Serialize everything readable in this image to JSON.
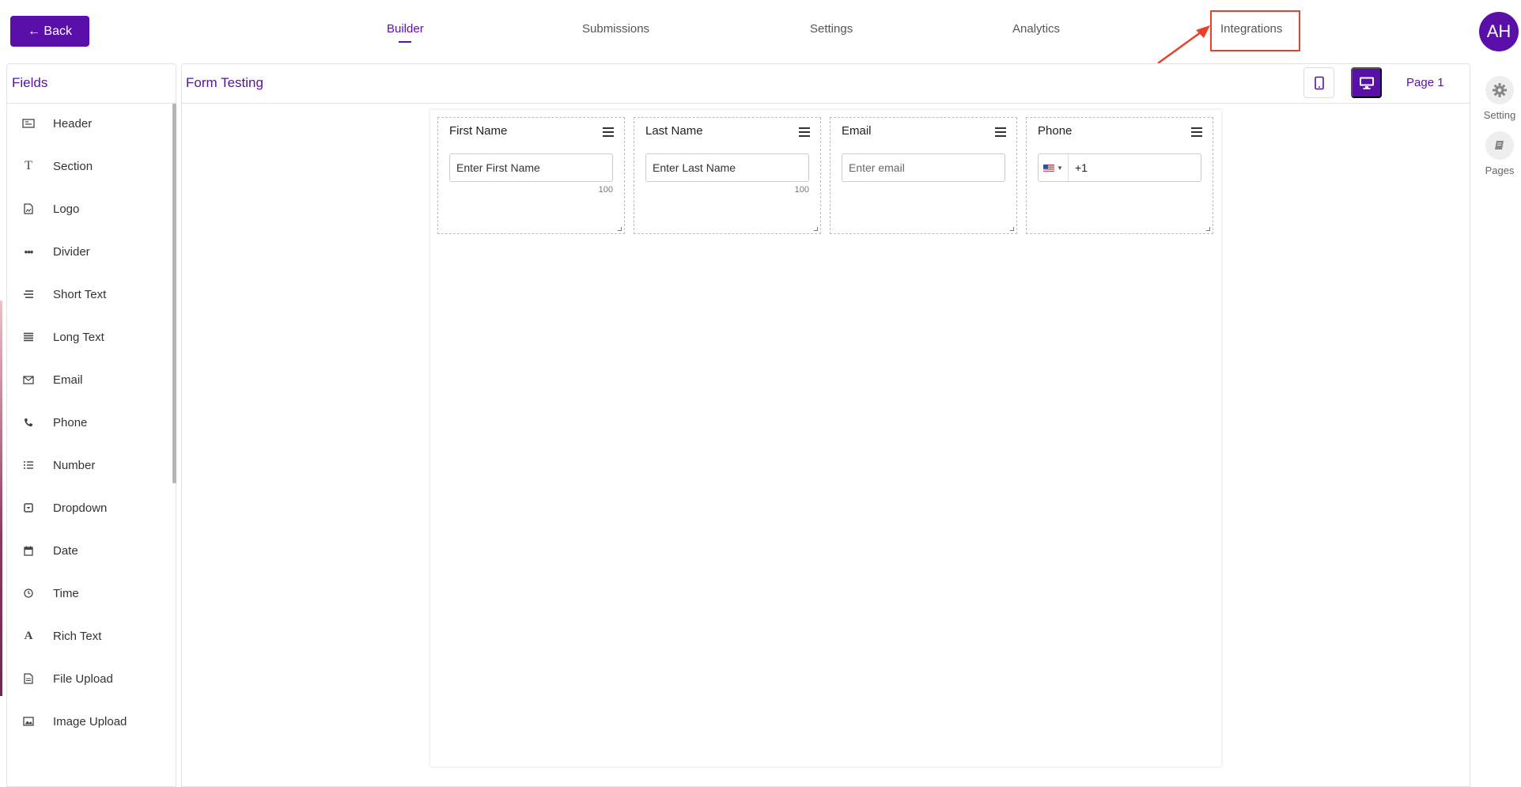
{
  "top_nav": {
    "back_label": "← Back",
    "tabs": [
      {
        "label": "Builder",
        "active": true
      },
      {
        "label": "Submissions",
        "active": false
      },
      {
        "label": "Settings",
        "active": false
      },
      {
        "label": "Analytics",
        "active": false
      },
      {
        "label": "Integrations",
        "active": false
      }
    ],
    "avatar_initials": "AH",
    "annotation": {
      "color": "#e8402a",
      "target": "Integrations"
    }
  },
  "sidebar": {
    "title": "Fields",
    "items": [
      {
        "label": "Header",
        "icon": "header-icon"
      },
      {
        "label": "Section",
        "icon": "text-t-icon"
      },
      {
        "label": "Logo",
        "icon": "image-file-icon"
      },
      {
        "label": "Divider",
        "icon": "dots-icon"
      },
      {
        "label": "Short Text",
        "icon": "short-text-icon"
      },
      {
        "label": "Long Text",
        "icon": "long-text-icon"
      },
      {
        "label": "Email",
        "icon": "envelope-icon"
      },
      {
        "label": "Phone",
        "icon": "phone-icon"
      },
      {
        "label": "Number",
        "icon": "numbered-list-icon"
      },
      {
        "label": "Dropdown",
        "icon": "dropdown-icon"
      },
      {
        "label": "Date",
        "icon": "calendar-icon"
      },
      {
        "label": "Time",
        "icon": "clock-icon"
      },
      {
        "label": "Rich Text",
        "icon": "rich-text-icon"
      },
      {
        "label": "File Upload",
        "icon": "file-icon"
      },
      {
        "label": "Image Upload",
        "icon": "image-icon"
      }
    ]
  },
  "main": {
    "form_title": "Form Testing",
    "page_label": "Page 1",
    "view_modes": [
      "tablet",
      "desktop"
    ],
    "active_view": "desktop"
  },
  "fields": [
    {
      "label": "First Name",
      "placeholder": "Enter First Name",
      "char_limit": "100"
    },
    {
      "label": "Last Name",
      "placeholder": "Enter Last Name",
      "char_limit": "100"
    },
    {
      "label": "Email",
      "placeholder": "Enter email"
    },
    {
      "label": "Phone",
      "dial_code": "+1"
    }
  ],
  "right_rail": {
    "setting_label": "Setting",
    "pages_label": "Pages"
  },
  "colors": {
    "brand": "#5a0fa8",
    "annotation": "#e8402a"
  }
}
